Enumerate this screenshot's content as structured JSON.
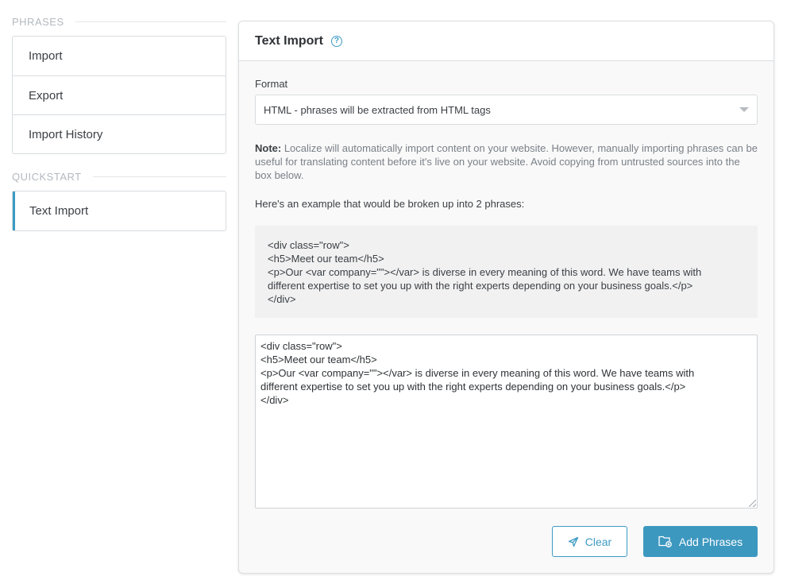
{
  "sidebar": {
    "phrases_header": "PHRASES",
    "phrases_items": [
      {
        "label": "Import"
      },
      {
        "label": "Export"
      },
      {
        "label": "Import History"
      }
    ],
    "quickstart_header": "QUICKSTART",
    "quickstart_items": [
      {
        "label": "Text Import",
        "active": true
      }
    ]
  },
  "card": {
    "title": "Text Import",
    "help_icon": "question-circle-icon",
    "format_label": "Format",
    "format_value": "HTML - phrases will be extracted from HTML tags",
    "note_label": "Note:",
    "note_text": " Localize will automatically import content on your website. However, manually importing phrases can be useful for translating content before it's live on your website. Avoid copying from untrusted sources into the box below.",
    "example_intro": "Here's an example that would be broken up into 2 phrases:",
    "example_lines": [
      "<div class=\"row\">",
      "<h5>Meet our team</h5>",
      "<p>Our <var company=\"\"></var> is diverse in every meaning of this word. We have teams with",
      "different expertise to set you up with the right experts depending on your business goals.</p>",
      "</div>"
    ],
    "textarea_lines": [
      "<div class=\"row\">",
      "<h5>Meet our team</h5>",
      "<p>Our <var company=\"\"></var> is diverse in every meaning of this word. We have teams with",
      "different expertise to set you up with the right experts depending on your business goals.</p>",
      "</div>"
    ],
    "clear_label": "Clear",
    "add_label": "Add Phrases"
  },
  "colors": {
    "accent": "#3d9bc4",
    "button_fill": "#3d98c0"
  }
}
